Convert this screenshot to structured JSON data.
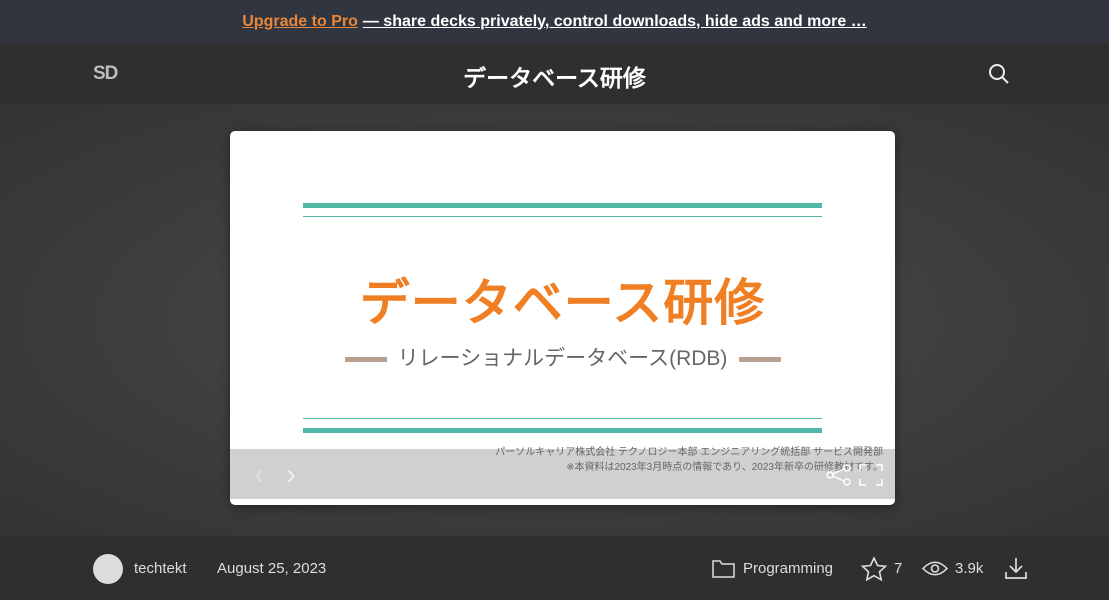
{
  "banner": {
    "pro_link": "Upgrade to Pro",
    "rest_link": "— share decks privately, control downloads, hide ads and more …"
  },
  "header": {
    "logo": "SD",
    "title": "データベース研修"
  },
  "slide": {
    "title": "データベース研修",
    "subtitle": "リレーショナルデータベース(RDB)",
    "credit_line1": "パーソルキャリア株式会社  テクノロジー本部  エンジニアリング統括部  サービス開発部",
    "credit_line2": "※本資料は2023年3月時点の情報であり、2023年新卒の研修教材です。",
    "prev": "‹",
    "next": "›"
  },
  "footer": {
    "author": "techtekt",
    "date": "August 25, 2023",
    "category": "Programming",
    "stars": "7",
    "views": "3.9k"
  },
  "colors": {
    "accent": "#e8873a",
    "teal": "#4fb8a6",
    "title_orange": "#ef7f22"
  }
}
